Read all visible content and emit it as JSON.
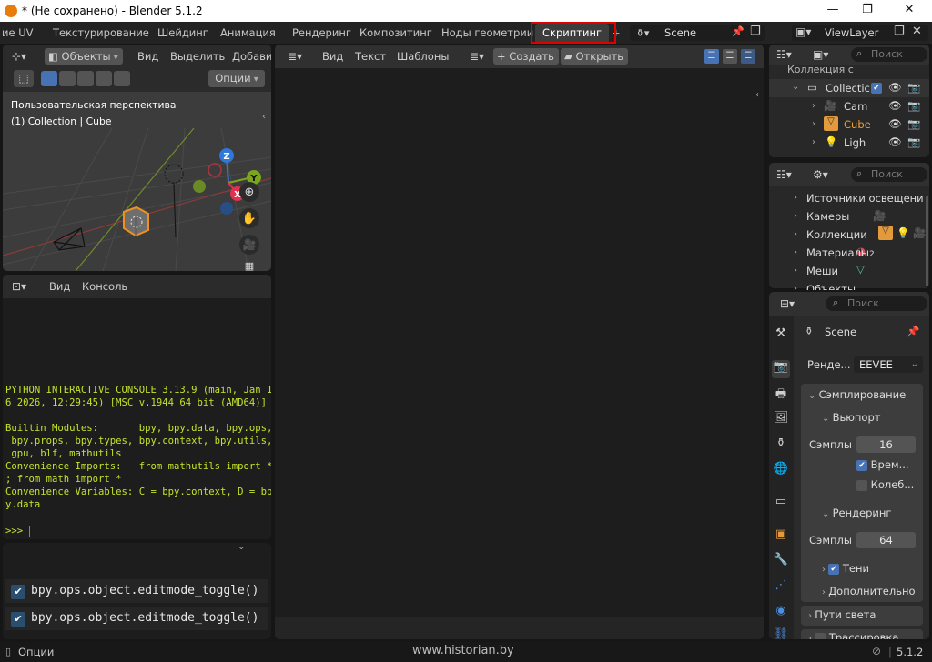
{
  "titlebar": {
    "title": "* (Не сохранено) - Blender 5.1.2",
    "minimize": "—",
    "maximize": "❐",
    "close": "✕"
  },
  "workspaces": [
    "ие UV",
    "Текстурирование",
    "Шейдинг",
    "Анимация",
    "Рендеринг",
    "Композитинг",
    "Ноды геометрии",
    "Скриптинг"
  ],
  "add_tab": "+",
  "scene": {
    "name": "Scene"
  },
  "viewlayer": {
    "name": "ViewLayer"
  },
  "viewport": {
    "mode": "Объекты",
    "menu": [
      "Вид",
      "Выделить",
      "Добави"
    ],
    "options": "Опции",
    "overlay_title": "Пользовательская перспектива",
    "overlay_sub": "(1) Collection | Cube",
    "gizmo": {
      "z": "Z",
      "y": "Y",
      "x": "X"
    }
  },
  "console_panel": {
    "menu": [
      "Вид",
      "Консоль"
    ],
    "lines": [
      "PYTHON INTERACTIVE CONSOLE 3.13.9 (main, Jan 1",
      "6 2026, 12:29:45) [MSC v.1944 64 bit (AMD64)]",
      "",
      "Builtin Modules:       bpy, bpy.data, bpy.ops,",
      " bpy.props, bpy.types, bpy.context, bpy.utils,",
      " gpu, blf, mathutils",
      "Convenience Imports:   from mathutils import *",
      "; from math import *",
      "Convenience Variables: C = bpy.context, D = bp",
      "y.data"
    ],
    "prompt": ">>> "
  },
  "info_panel": {
    "items": [
      "bpy.ops.object.editmode_toggle()",
      "bpy.ops.object.editmode_toggle()"
    ]
  },
  "text_editor": {
    "menu": [
      "Вид",
      "Текст",
      "Шаблоны"
    ],
    "new_label": "Создать",
    "open_label": "Открыть"
  },
  "outliner": {
    "search_placeholder": "Поиск",
    "root": "Коллекция с",
    "collection": "Collectic",
    "objects": [
      "Cam",
      "Cube",
      "Ligh"
    ]
  },
  "datablocks": {
    "search_placeholder": "Поиск",
    "items": [
      "Источники освещения",
      "Камеры",
      "Коллекции",
      "Материалы",
      "Меши",
      "Объекты"
    ],
    "material_count": "2"
  },
  "properties": {
    "search_placeholder": "Поиск",
    "scene_label": "Scene",
    "render_engine_label": "Рендe...",
    "render_engine": "EEVEE",
    "sampling": "Сэмплирование",
    "viewport": "Вьюпорт",
    "samples_label": "Сэмплы",
    "viewport_samples": "16",
    "temporal": "Врем...",
    "jitter": "Колеб...",
    "render": "Рендеринг",
    "render_samples": "64",
    "shadows": "Тени",
    "advanced": "Дополнительно",
    "light_paths": "Пути света",
    "raytracing": "Трассировка"
  },
  "status": {
    "options": "Опции",
    "watermark": "www.historian.by",
    "version": "5.1.2"
  }
}
